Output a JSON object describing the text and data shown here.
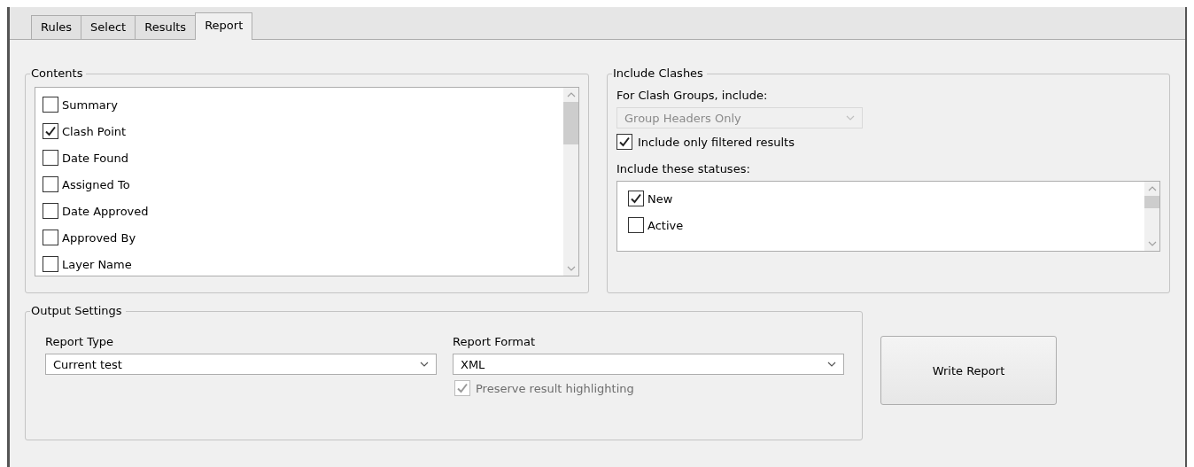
{
  "tabs": [
    {
      "label": "Rules",
      "selected": false
    },
    {
      "label": "Select",
      "selected": false
    },
    {
      "label": "Results",
      "selected": false
    },
    {
      "label": "Report",
      "selected": true
    }
  ],
  "contents": {
    "title": "Contents",
    "items": [
      {
        "label": "Summary",
        "checked": false
      },
      {
        "label": "Clash Point",
        "checked": true
      },
      {
        "label": "Date Found",
        "checked": false
      },
      {
        "label": "Assigned To",
        "checked": false
      },
      {
        "label": "Date Approved",
        "checked": false
      },
      {
        "label": "Approved By",
        "checked": false
      },
      {
        "label": "Layer Name",
        "checked": false
      }
    ]
  },
  "include_clashes": {
    "title": "Include Clashes",
    "group_label": "For Clash Groups, include:",
    "group_select": {
      "value": "Group Headers Only",
      "disabled": true
    },
    "filtered": {
      "label": "Include only filtered results",
      "checked": true
    },
    "statuses_label": "Include these statuses:",
    "statuses": [
      {
        "label": "New",
        "checked": true
      },
      {
        "label": "Active",
        "checked": false
      }
    ]
  },
  "output_settings": {
    "title": "Output Settings",
    "report_type": {
      "label": "Report Type",
      "value": "Current test"
    },
    "report_format": {
      "label": "Report Format",
      "value": "XML"
    },
    "preserve": {
      "label": "Preserve result highlighting",
      "checked": true,
      "disabled": true
    }
  },
  "write_button": "Write Report"
}
